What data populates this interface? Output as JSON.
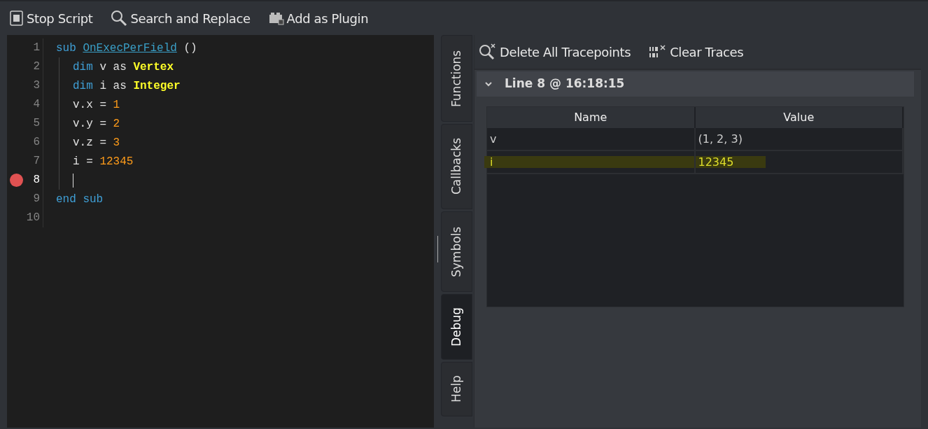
{
  "toolbar": [
    {
      "label": "Stop Script"
    },
    {
      "label": "Search and Replace"
    },
    {
      "label": "Add as Plugin"
    }
  ],
  "editor": {
    "lines": [
      {
        "number": "1",
        "indented": false,
        "breakpoint": false,
        "current": false,
        "cursor": false,
        "tokens": [
          {
            "text": "sub",
            "kind": "keyword"
          },
          {
            "text": "OnExecPerField",
            "kind": "function"
          },
          {
            "text": "()",
            "kind": "plain"
          }
        ]
      },
      {
        "number": "2",
        "indented": true,
        "breakpoint": false,
        "current": false,
        "cursor": false,
        "tokens": [
          {
            "text": "dim",
            "kind": "keyword"
          },
          {
            "text": "v",
            "kind": "plain"
          },
          {
            "text": "as",
            "kind": "plain"
          },
          {
            "text": "Vertex",
            "kind": "type"
          }
        ]
      },
      {
        "number": "3",
        "indented": true,
        "breakpoint": false,
        "current": false,
        "cursor": false,
        "tokens": [
          {
            "text": "dim",
            "kind": "keyword"
          },
          {
            "text": "i",
            "kind": "plain"
          },
          {
            "text": "as",
            "kind": "plain"
          },
          {
            "text": "Integer",
            "kind": "type"
          }
        ]
      },
      {
        "number": "4",
        "indented": true,
        "breakpoint": false,
        "current": false,
        "cursor": false,
        "tokens": [
          {
            "text": "v.x",
            "kind": "plain"
          },
          {
            "text": "=",
            "kind": "plain"
          },
          {
            "text": "1",
            "kind": "number"
          }
        ]
      },
      {
        "number": "5",
        "indented": true,
        "breakpoint": false,
        "current": false,
        "cursor": false,
        "tokens": [
          {
            "text": "v.y",
            "kind": "plain"
          },
          {
            "text": "=",
            "kind": "plain"
          },
          {
            "text": "2",
            "kind": "number"
          }
        ]
      },
      {
        "number": "6",
        "indented": true,
        "breakpoint": false,
        "current": false,
        "cursor": false,
        "tokens": [
          {
            "text": "v.z",
            "kind": "plain"
          },
          {
            "text": "=",
            "kind": "plain"
          },
          {
            "text": "3",
            "kind": "number"
          }
        ]
      },
      {
        "number": "7",
        "indented": true,
        "breakpoint": false,
        "current": false,
        "cursor": false,
        "tokens": [
          {
            "text": "i",
            "kind": "plain"
          },
          {
            "text": "=",
            "kind": "plain"
          },
          {
            "text": "12345",
            "kind": "number"
          }
        ]
      },
      {
        "number": "8",
        "indented": true,
        "breakpoint": true,
        "current": true,
        "cursor": true
      },
      {
        "number": "9",
        "indented": false,
        "breakpoint": false,
        "current": false,
        "cursor": false,
        "tokens": [
          {
            "text": "end",
            "kind": "keyword"
          },
          {
            "text": "sub",
            "kind": "keyword"
          }
        ]
      },
      {
        "number": "10",
        "indented": false,
        "breakpoint": false,
        "current": false,
        "cursor": false
      }
    ]
  },
  "side_tabs": [
    {
      "label": "Functions",
      "selected": false
    },
    {
      "label": "Callbacks",
      "selected": false
    },
    {
      "label": "Symbols",
      "selected": false
    },
    {
      "label": "Debug",
      "selected": true
    },
    {
      "label": "Help",
      "selected": false
    }
  ],
  "debug_toolbar": [
    {
      "label": "Delete All Tracepoints"
    },
    {
      "label": "Clear Traces"
    }
  ],
  "trace": {
    "title": "Line 8 @ 16:18:15",
    "expanded": true,
    "table": {
      "columns": [
        "Name",
        "Value"
      ],
      "rows": [
        {
          "cells": [
            "v",
            "(1, 2, 3)"
          ],
          "highlighted": false
        },
        {
          "cells": [
            "i",
            "12345"
          ],
          "highlighted": true
        }
      ]
    }
  }
}
